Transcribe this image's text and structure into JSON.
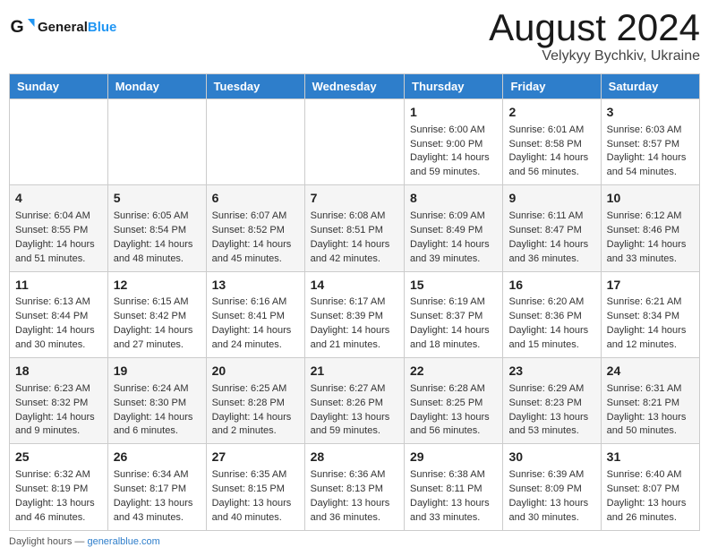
{
  "header": {
    "logo_text_general": "General",
    "logo_text_blue": "Blue",
    "title": "August 2024",
    "subtitle": "Velykyy Bychkiv, Ukraine"
  },
  "weekdays": [
    "Sunday",
    "Monday",
    "Tuesday",
    "Wednesday",
    "Thursday",
    "Friday",
    "Saturday"
  ],
  "weeks": [
    [
      {
        "day": "",
        "info": ""
      },
      {
        "day": "",
        "info": ""
      },
      {
        "day": "",
        "info": ""
      },
      {
        "day": "",
        "info": ""
      },
      {
        "day": "1",
        "info": "Sunrise: 6:00 AM\nSunset: 9:00 PM\nDaylight: 14 hours and 59 minutes."
      },
      {
        "day": "2",
        "info": "Sunrise: 6:01 AM\nSunset: 8:58 PM\nDaylight: 14 hours and 56 minutes."
      },
      {
        "day": "3",
        "info": "Sunrise: 6:03 AM\nSunset: 8:57 PM\nDaylight: 14 hours and 54 minutes."
      }
    ],
    [
      {
        "day": "4",
        "info": "Sunrise: 6:04 AM\nSunset: 8:55 PM\nDaylight: 14 hours and 51 minutes."
      },
      {
        "day": "5",
        "info": "Sunrise: 6:05 AM\nSunset: 8:54 PM\nDaylight: 14 hours and 48 minutes."
      },
      {
        "day": "6",
        "info": "Sunrise: 6:07 AM\nSunset: 8:52 PM\nDaylight: 14 hours and 45 minutes."
      },
      {
        "day": "7",
        "info": "Sunrise: 6:08 AM\nSunset: 8:51 PM\nDaylight: 14 hours and 42 minutes."
      },
      {
        "day": "8",
        "info": "Sunrise: 6:09 AM\nSunset: 8:49 PM\nDaylight: 14 hours and 39 minutes."
      },
      {
        "day": "9",
        "info": "Sunrise: 6:11 AM\nSunset: 8:47 PM\nDaylight: 14 hours and 36 minutes."
      },
      {
        "day": "10",
        "info": "Sunrise: 6:12 AM\nSunset: 8:46 PM\nDaylight: 14 hours and 33 minutes."
      }
    ],
    [
      {
        "day": "11",
        "info": "Sunrise: 6:13 AM\nSunset: 8:44 PM\nDaylight: 14 hours and 30 minutes."
      },
      {
        "day": "12",
        "info": "Sunrise: 6:15 AM\nSunset: 8:42 PM\nDaylight: 14 hours and 27 minutes."
      },
      {
        "day": "13",
        "info": "Sunrise: 6:16 AM\nSunset: 8:41 PM\nDaylight: 14 hours and 24 minutes."
      },
      {
        "day": "14",
        "info": "Sunrise: 6:17 AM\nSunset: 8:39 PM\nDaylight: 14 hours and 21 minutes."
      },
      {
        "day": "15",
        "info": "Sunrise: 6:19 AM\nSunset: 8:37 PM\nDaylight: 14 hours and 18 minutes."
      },
      {
        "day": "16",
        "info": "Sunrise: 6:20 AM\nSunset: 8:36 PM\nDaylight: 14 hours and 15 minutes."
      },
      {
        "day": "17",
        "info": "Sunrise: 6:21 AM\nSunset: 8:34 PM\nDaylight: 14 hours and 12 minutes."
      }
    ],
    [
      {
        "day": "18",
        "info": "Sunrise: 6:23 AM\nSunset: 8:32 PM\nDaylight: 14 hours and 9 minutes."
      },
      {
        "day": "19",
        "info": "Sunrise: 6:24 AM\nSunset: 8:30 PM\nDaylight: 14 hours and 6 minutes."
      },
      {
        "day": "20",
        "info": "Sunrise: 6:25 AM\nSunset: 8:28 PM\nDaylight: 14 hours and 2 minutes."
      },
      {
        "day": "21",
        "info": "Sunrise: 6:27 AM\nSunset: 8:26 PM\nDaylight: 13 hours and 59 minutes."
      },
      {
        "day": "22",
        "info": "Sunrise: 6:28 AM\nSunset: 8:25 PM\nDaylight: 13 hours and 56 minutes."
      },
      {
        "day": "23",
        "info": "Sunrise: 6:29 AM\nSunset: 8:23 PM\nDaylight: 13 hours and 53 minutes."
      },
      {
        "day": "24",
        "info": "Sunrise: 6:31 AM\nSunset: 8:21 PM\nDaylight: 13 hours and 50 minutes."
      }
    ],
    [
      {
        "day": "25",
        "info": "Sunrise: 6:32 AM\nSunset: 8:19 PM\nDaylight: 13 hours and 46 minutes."
      },
      {
        "day": "26",
        "info": "Sunrise: 6:34 AM\nSunset: 8:17 PM\nDaylight: 13 hours and 43 minutes."
      },
      {
        "day": "27",
        "info": "Sunrise: 6:35 AM\nSunset: 8:15 PM\nDaylight: 13 hours and 40 minutes."
      },
      {
        "day": "28",
        "info": "Sunrise: 6:36 AM\nSunset: 8:13 PM\nDaylight: 13 hours and 36 minutes."
      },
      {
        "day": "29",
        "info": "Sunrise: 6:38 AM\nSunset: 8:11 PM\nDaylight: 13 hours and 33 minutes."
      },
      {
        "day": "30",
        "info": "Sunrise: 6:39 AM\nSunset: 8:09 PM\nDaylight: 13 hours and 30 minutes."
      },
      {
        "day": "31",
        "info": "Sunrise: 6:40 AM\nSunset: 8:07 PM\nDaylight: 13 hours and 26 minutes."
      }
    ]
  ],
  "footer": {
    "text": "Daylight hours",
    "source": "generalblue.com"
  }
}
